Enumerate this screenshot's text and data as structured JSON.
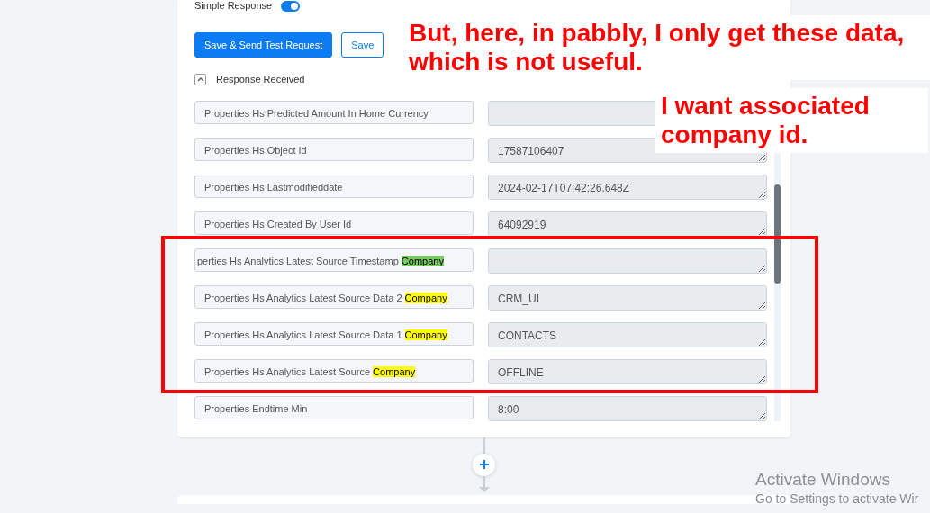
{
  "simple_response": {
    "label": "Simple Response",
    "on": true
  },
  "buttons": [
    {
      "label": "Save & Send Test Request",
      "kind": "primary"
    },
    {
      "label": "Save",
      "kind": "outline"
    }
  ],
  "response_section": {
    "label": "Response Received",
    "expanded": true
  },
  "fields": [
    {
      "label": "Properties Hs Predicted Amount In Home Currency"
    },
    {
      "label": "Properties Hs Object Id",
      "value": "17587106407"
    },
    {
      "label": "Properties Hs Lastmodifieddate",
      "value": "2024-02-17T07:42:26.648Z"
    },
    {
      "label": "Properties Hs Created By User Id",
      "value": "64092919"
    },
    {
      "label": "perties Hs Analytics Latest Source Timestamp",
      "highlight": {
        "text": "Company",
        "color": "#78c864"
      }
    },
    {
      "label": "Properties Hs Analytics Latest Source Data 2",
      "highlight": {
        "text": "Company",
        "color": "#ffff00"
      },
      "value": "CRM_UI"
    },
    {
      "label": "Properties Hs Analytics Latest Source Data 1",
      "highlight": {
        "text": "Company",
        "color": "#ffff00"
      },
      "value": "CONTACTS"
    },
    {
      "label": "Properties Hs Analytics Latest Source",
      "highlight": {
        "text": "Company",
        "color": "#ffff00"
      },
      "value": "OFFLINE"
    },
    {
      "label": "Properties Endtime Min",
      "value": "8:00"
    }
  ],
  "annotations": [
    {
      "kind": "note",
      "text": "But, here, in pabbly, I only get these data, which is not useful."
    },
    {
      "kind": "note",
      "text": "I want associated company id."
    },
    {
      "kind": "frame"
    }
  ],
  "os_notice": {
    "title": "Activate Windows",
    "subtitle": "Go to Settings to activate Wir"
  }
}
